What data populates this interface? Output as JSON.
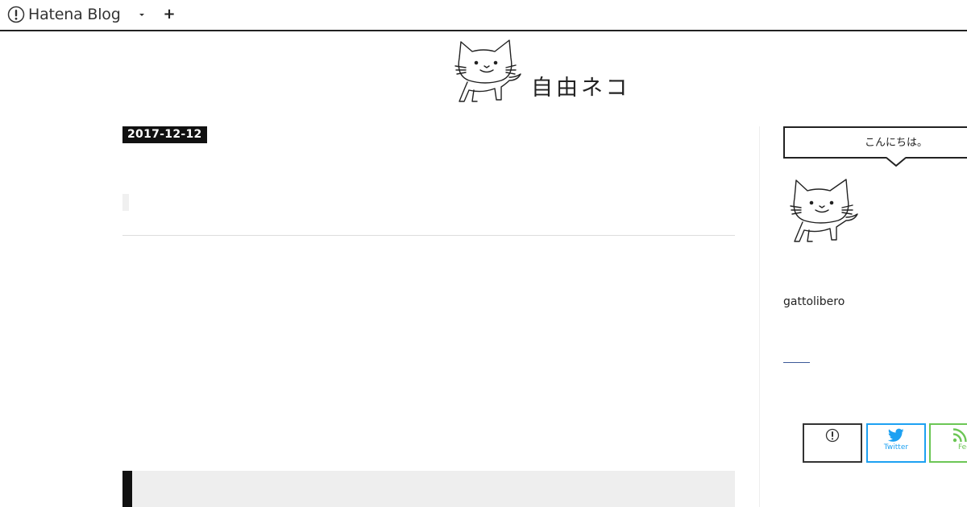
{
  "topbar": {
    "brand_label": "Hatena Blog",
    "dropdown_icon": "caret-down-icon",
    "add_icon": "plus-icon",
    "add_label": "+"
  },
  "header": {
    "site_title": "自由ネコ",
    "logo_icon": "cat-drawing-icon"
  },
  "article": {
    "date": "2017-12-12"
  },
  "sidebar": {
    "greeting": "こんにちは。",
    "avatar_icon": "cat-drawing-icon",
    "username": "gattolibero",
    "share_buttons": [
      {
        "label": "",
        "icon": "hatena-bookmark-icon",
        "color": "#333333"
      },
      {
        "label": "Twitter",
        "icon": "twitter-bird-icon",
        "color": "#1da1f2"
      },
      {
        "label": "Feedly",
        "icon": "rss-feed-icon",
        "color": "#6cc655"
      }
    ]
  },
  "colors": {
    "text": "#222222",
    "badge_background": "#111111",
    "divider": "#dddddd",
    "quote_background": "#eeeeee",
    "twitter": "#1da1f2",
    "feedly": "#6cc655"
  }
}
